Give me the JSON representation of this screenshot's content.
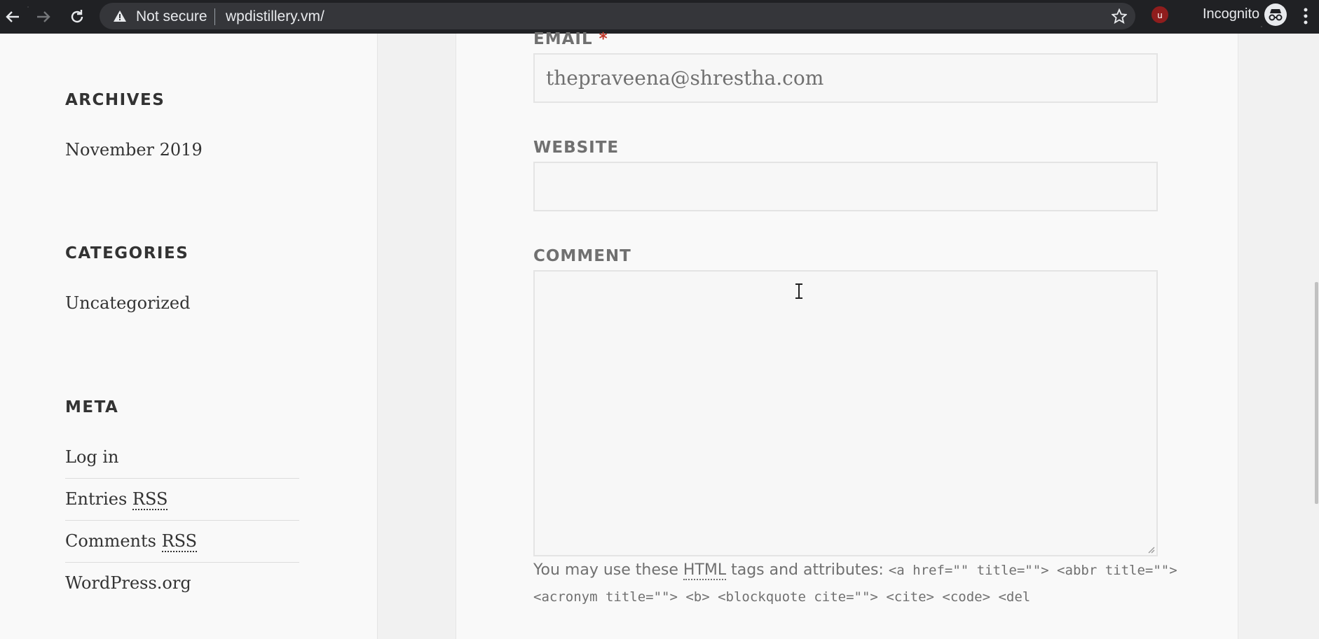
{
  "browser": {
    "security_label": "Not secure",
    "url": "wpdistillery.vm/",
    "incognito_label": "Incognito",
    "extension_badge": "u",
    "icons": [
      "back-icon",
      "forward-icon",
      "reload-icon",
      "warning-icon",
      "star-icon",
      "extension-icon",
      "incognito-icon",
      "menu-icon"
    ]
  },
  "sidebar": {
    "archives": {
      "title": "ARCHIVES",
      "items": [
        "November 2019"
      ]
    },
    "categories": {
      "title": "CATEGORIES",
      "items": [
        "Uncategorized"
      ]
    },
    "meta": {
      "title": "META",
      "login": "Log in",
      "entries_prefix": "Entries ",
      "comments_prefix": "Comments ",
      "rss_abbr": "RSS",
      "wordpress": "WordPress.org"
    }
  },
  "comment_form": {
    "email_label": "EMAIL",
    "required_mark": "*",
    "email_value": "thepraveena@shrestha.com",
    "website_label": "WEBSITE",
    "website_value": "",
    "comment_label": "COMMENT",
    "comment_value": "",
    "allowed_prefix": "You may use these ",
    "allowed_abbr": "HTML",
    "allowed_mid": " tags and attributes: ",
    "allowed_code": "<a href=\"\" title=\"\"> <abbr title=\"\"> <acronym title=\"\"> <b> <blockquote cite=\"\"> <cite> <code> <del"
  },
  "colors": {
    "toolbar_bg": "#202124",
    "omnibox_bg": "#35363a",
    "required": "#c0392b",
    "label_text": "#707070"
  }
}
